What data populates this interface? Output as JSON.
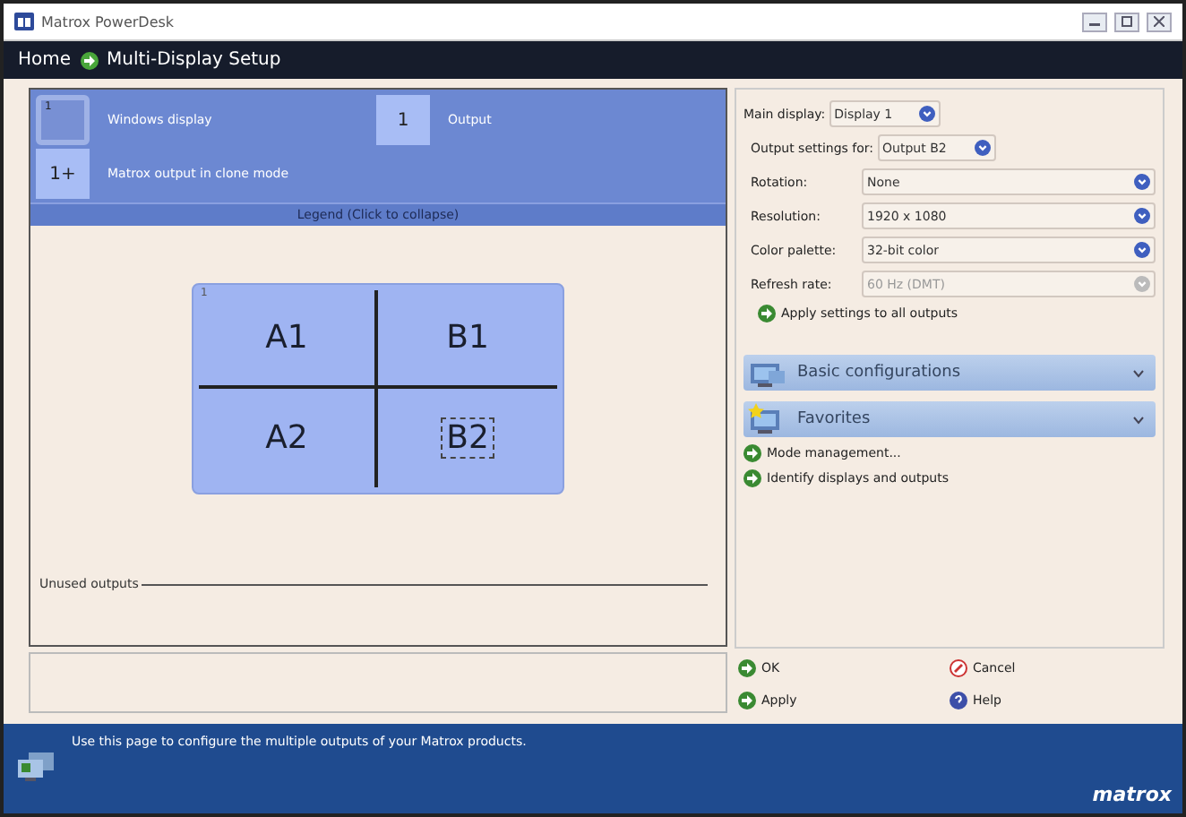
{
  "window": {
    "title": "Matrox PowerDesk"
  },
  "breadcrumb": {
    "home": "Home",
    "page": "Multi-Display Setup"
  },
  "legend": {
    "expanded": true,
    "toggle": "Legend (Click to collapse)",
    "items": [
      {
        "kind": "windows",
        "badge": "1",
        "label": "Windows display"
      },
      {
        "kind": "output",
        "badge": "1",
        "label": "Output"
      },
      {
        "kind": "clone",
        "badge": "1+",
        "label": "Matrox output in clone mode"
      }
    ]
  },
  "display": {
    "number": "1",
    "outputs": [
      {
        "label": "A1",
        "selected": false
      },
      {
        "label": "B1",
        "selected": false
      },
      {
        "label": "A2",
        "selected": false
      },
      {
        "label": "B2",
        "selected": true
      }
    ]
  },
  "unused_outputs": "Unused outputs",
  "main_display": {
    "label": "Main display:",
    "value": "Display 1"
  },
  "output_settings": {
    "label": "Output settings for:",
    "value": "Output B2"
  },
  "settings": [
    {
      "label": "Rotation:",
      "value": "None",
      "disabled": false
    },
    {
      "label": "Resolution:",
      "value": "1920 x 1080",
      "disabled": false
    },
    {
      "label": "Color palette:",
      "value": "32-bit color",
      "disabled": false
    },
    {
      "label": "Refresh rate:",
      "value": "60 Hz (DMT)",
      "disabled": true
    }
  ],
  "apply_all": "Apply settings to all outputs",
  "sections": [
    {
      "kind": "basic",
      "label": "Basic configurations",
      "expanded": false
    },
    {
      "kind": "favorites",
      "label": "Favorites",
      "expanded": false
    }
  ],
  "links": [
    "Mode management...",
    "Identify displays and outputs"
  ],
  "buttons": [
    {
      "kind": "ok",
      "label": "OK"
    },
    {
      "kind": "cancel",
      "label": "Cancel"
    },
    {
      "kind": "apply",
      "label": "Apply"
    },
    {
      "kind": "help",
      "label": "Help"
    }
  ],
  "footer": {
    "message": "Use this page to configure the multiple outputs of your Matrox products.",
    "logo": "matrox"
  }
}
